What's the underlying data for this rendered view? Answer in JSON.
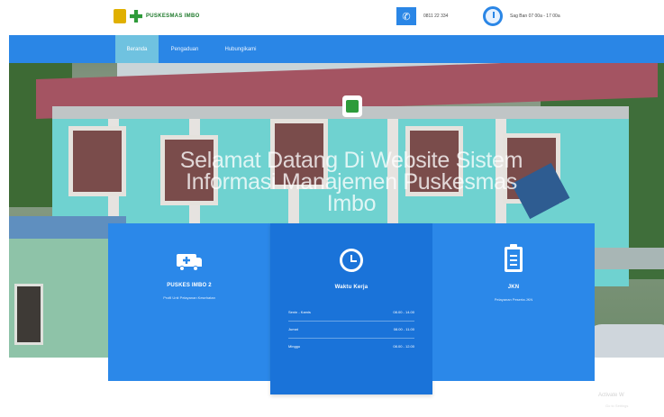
{
  "topbar": {
    "logo_text": "PUSKESMAS IMBO",
    "phone_text": "0811 22 334",
    "hours_text": "Sag Ban 07 00a - 17 00a"
  },
  "nav": {
    "items": [
      {
        "label": "Beranda"
      },
      {
        "label": "Pengaduan"
      },
      {
        "label": "Hubungikami"
      }
    ]
  },
  "hero": {
    "title_line1": "Selamat Datang Di Website Sistem",
    "title_line2": "Informasi Manajemen Puskesmas",
    "title_line3": "Imbo"
  },
  "cards": {
    "profile": {
      "title": "PUSKES IMBO 2",
      "subtitle": "Profil Unit Pelayanan Kesehatan"
    },
    "hours": {
      "title": "Waktu Kerja",
      "rows": [
        {
          "day": "Senin - Kamis",
          "time": "08.00 - 14.00"
        },
        {
          "day": "Jumat",
          "time": "08.00 - 11.00"
        },
        {
          "day": "Minggu",
          "time": "08.00 - 12.00"
        }
      ]
    },
    "jkn": {
      "title": "JKN",
      "subtitle": "Pelayanan Peserta JKN"
    }
  },
  "watermark": {
    "line1": "Activate W",
    "line2": "Go to Settings"
  },
  "colors": {
    "primary": "#2a86e6",
    "card_mid": "#1a73d9",
    "nav_active": "#6fc2e0"
  }
}
